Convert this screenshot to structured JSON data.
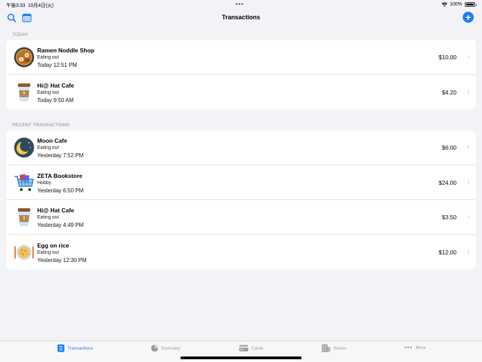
{
  "status_bar": {
    "time": "午後3:33",
    "date": "10月4日(火)",
    "battery": "100%"
  },
  "nav": {
    "title": "Transactions",
    "search_icon": "search-icon",
    "calendar_icon": "calendar-icon",
    "add_label": "+"
  },
  "sections": {
    "today": "TODAY",
    "recent": "RECENT TRANSACTIONS"
  },
  "today": [
    {
      "name": "Ramen Noddle Shop",
      "category": "Eating out",
      "time": "Today 12:51 PM",
      "amount": "$10.00",
      "icon": "ramen-icon"
    },
    {
      "name": "Hi@ Hat Cafe",
      "category": "Eating out",
      "time": "Today 9:50 AM",
      "amount": "$4.20",
      "icon": "coffee-cup-icon"
    }
  ],
  "recent": [
    {
      "name": "Moon Cafe",
      "category": "Eating out",
      "time": "Yesterday 7:52 PM",
      "amount": "$6.00",
      "icon": "moon-icon"
    },
    {
      "name": "ZETA Bookstore",
      "category": "Hobby",
      "time": "Yesterday 6:50 PM",
      "amount": "$24.00",
      "icon": "shopping-cart-icon"
    },
    {
      "name": "Hi@ Hat Cafe",
      "category": "Eating out",
      "time": "Yesterday 4:49 PM",
      "amount": "$3.50",
      "icon": "coffee-cup-icon"
    },
    {
      "name": "Egg on rice",
      "category": "Eating out",
      "time": "Yesterday 12:30 PM",
      "amount": "$12.00",
      "icon": "egg-rice-icon"
    }
  ],
  "tabs": [
    {
      "label": "Transactions",
      "icon": "list-icon",
      "active": true
    },
    {
      "label": "Summary",
      "icon": "pie-chart-icon",
      "active": false
    },
    {
      "label": "Cards",
      "icon": "card-icon",
      "active": false
    },
    {
      "label": "Stores",
      "icon": "building-icon",
      "active": false
    },
    {
      "label": "More",
      "icon": "ellipsis-icon",
      "active": false
    }
  ],
  "colors": {
    "accent": "#1a7ff5",
    "background": "#f2f2f7",
    "inactive_tab": "#9a9a9e"
  }
}
